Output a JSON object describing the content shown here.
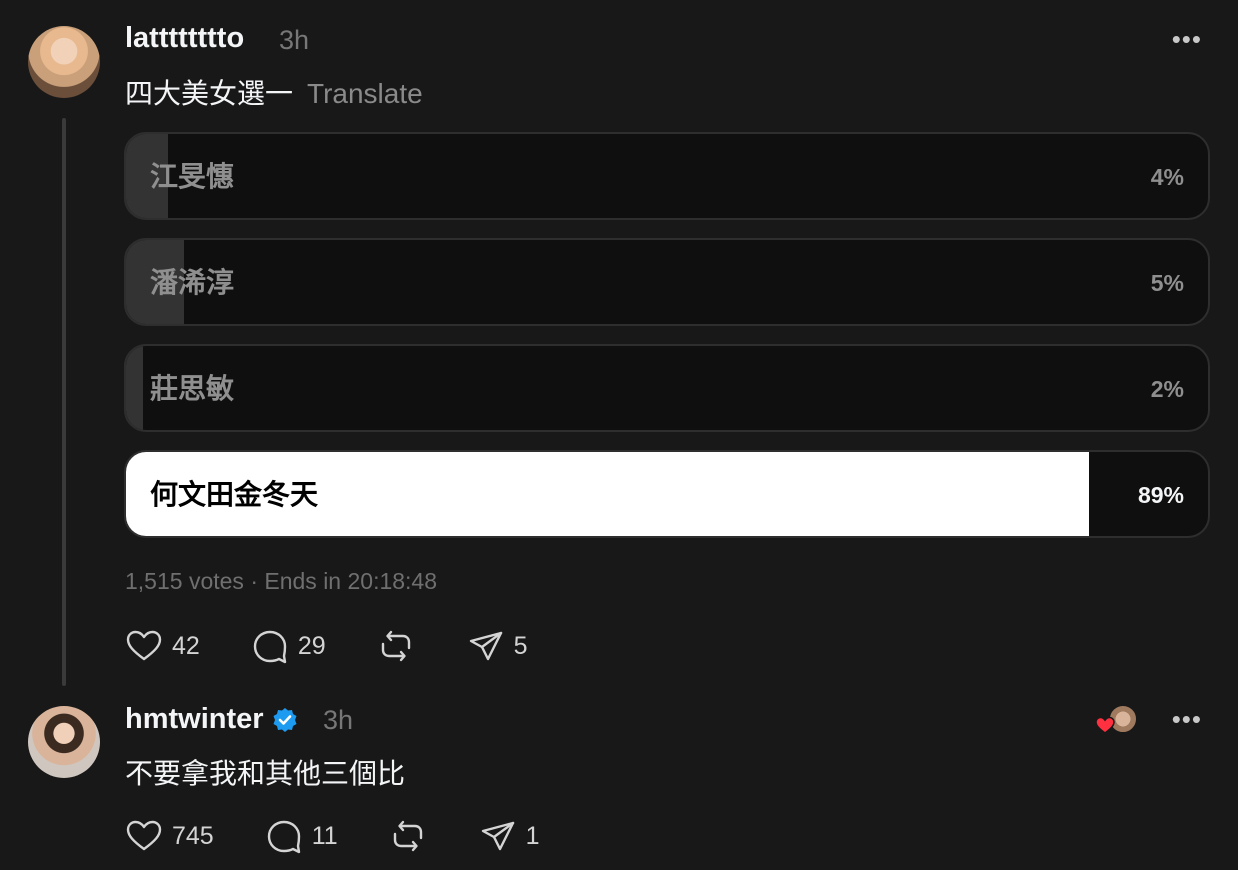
{
  "post": {
    "username": "latttttttto",
    "time": "3h",
    "more": "•••",
    "text": "四大美女選一",
    "translate": "Translate",
    "poll": {
      "options": [
        {
          "label": "江旻憓",
          "percent_text": "4%",
          "percent": 4
        },
        {
          "label": "潘浠淳",
          "percent_text": "5%",
          "percent": 5
        },
        {
          "label": "莊思敏",
          "percent_text": "2%",
          "percent": 2
        },
        {
          "label": "何文田金冬天",
          "percent_text": "89%",
          "percent": 89,
          "selected": true
        }
      ],
      "votes": "1,515 votes",
      "separator": "·",
      "ends": "Ends in 20:18:48"
    },
    "actions": {
      "likes": "42",
      "comments": "29",
      "shares": "5"
    }
  },
  "reply": {
    "username": "hmtwinter",
    "verified": true,
    "time": "3h",
    "more": "•••",
    "text": "不要拿我和其他三個比",
    "actions": {
      "likes": "745",
      "comments": "11",
      "shares": "1"
    }
  },
  "colors": {
    "background": "#181818",
    "accent_verified": "#1d9bf0",
    "heart": "#ff3040"
  }
}
